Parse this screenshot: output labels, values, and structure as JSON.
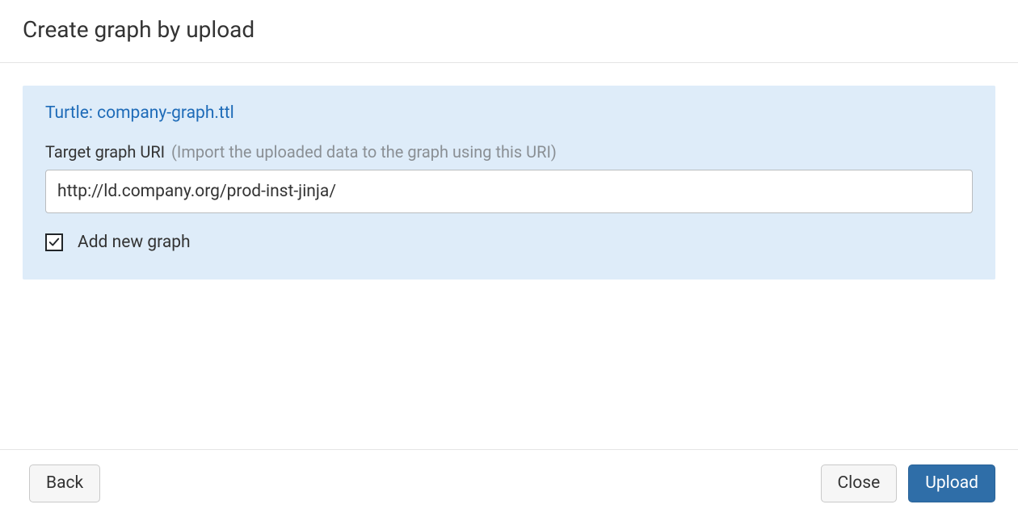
{
  "header": {
    "title": "Create graph by upload"
  },
  "file": {
    "link_text": "Turtle: company-graph.ttl"
  },
  "target": {
    "label": "Target graph URI",
    "hint": "(Import the uploaded data to the graph using this URI)",
    "value": "http://ld.company.org/prod-inst-jinja/"
  },
  "checkbox": {
    "label": "Add new graph",
    "checked": true
  },
  "footer": {
    "back": "Back",
    "close": "Close",
    "upload": "Upload"
  }
}
